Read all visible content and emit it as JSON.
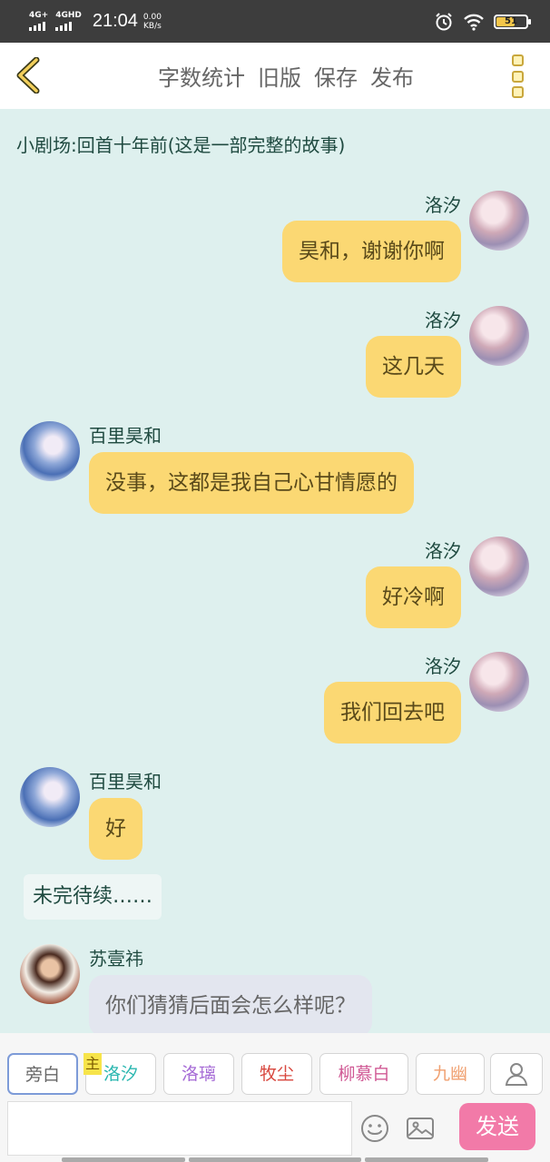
{
  "status_bar": {
    "network1": "4G+",
    "network2": "4GHD",
    "time": "21:04",
    "speed_value": "0.00",
    "speed_unit": "KB/s",
    "battery": "51",
    "icons": [
      "alarm-icon",
      "wifi-icon",
      "battery-icon"
    ]
  },
  "header": {
    "back_icon": "chevron-left-icon",
    "menu": [
      "字数统计",
      "旧版",
      "保存",
      "发布"
    ],
    "more_icon": "kebab-menu-icon"
  },
  "story": {
    "title": "小剧场:回首十年前(这是一部完整的故事)",
    "messages": [
      {
        "side": "right",
        "name": "洛汐",
        "text": "昊和，谢谢你啊"
      },
      {
        "side": "right",
        "name": "洛汐",
        "text": "这几天"
      },
      {
        "side": "left",
        "name": "百里昊和",
        "text": "没事，这都是我自己心甘情愿的"
      },
      {
        "side": "right",
        "name": "洛汐",
        "text": "好冷啊"
      },
      {
        "side": "right",
        "name": "洛汐",
        "text": "我们回去吧"
      },
      {
        "side": "left",
        "name": "百里昊和",
        "text": "好"
      }
    ],
    "narration": "未完待续……",
    "last": {
      "name": "苏壹祎",
      "text": "你们猜猜后面会怎么样呢？"
    }
  },
  "characters": [
    {
      "label": "旁白",
      "color": "#666666"
    },
    {
      "label": "洛汐",
      "color": "#2bb7b0"
    },
    {
      "label": "洛璃",
      "color": "#a66bd6"
    },
    {
      "label": "牧尘",
      "color": "#d8483f"
    },
    {
      "label": "柳慕白",
      "color": "#d05a95"
    },
    {
      "label": "九幽",
      "color": "#f0a070"
    }
  ],
  "main_badge": "主",
  "add_character_icon": "person-icon",
  "input_bar": {
    "placeholder": "",
    "emoji_icon": "smiley-icon",
    "image_icon": "image-icon",
    "send_label": "发送"
  }
}
